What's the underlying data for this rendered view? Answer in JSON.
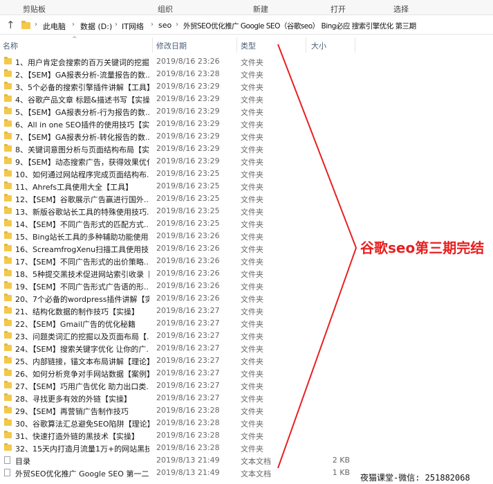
{
  "ribbon": {
    "groups": [
      "剪贴板",
      "组织",
      "新建",
      "打开",
      "选择"
    ]
  },
  "address_bar": {
    "crumbs": [
      "此电脑",
      "数据 (D:)",
      "IT网络",
      "seo",
      "外贸SEO优化推广 Google SEO（谷歌seo） Bing必应 搜索引擎优化 第三期"
    ]
  },
  "columns": {
    "name": "名称",
    "date": "修改日期",
    "type": "类型",
    "size": "大小"
  },
  "files": [
    {
      "name": "1、用户肯定会搜索的百万关键词的挖掘...",
      "date": "2019/8/16 23:26",
      "type": "文件夹",
      "size": "",
      "kind": "folder"
    },
    {
      "name": "2、【SEM】GA报表分析-流量报告的数...",
      "date": "2019/8/16 23:28",
      "type": "文件夹",
      "size": "",
      "kind": "folder"
    },
    {
      "name": "3、5个必备的搜索引擎插件讲解【工具】",
      "date": "2019/8/16 23:29",
      "type": "文件夹",
      "size": "",
      "kind": "folder"
    },
    {
      "name": "4、谷歌产品文章 标题&描述书写【实操】",
      "date": "2019/8/16 23:29",
      "type": "文件夹",
      "size": "",
      "kind": "folder"
    },
    {
      "name": "5、【SEM】GA报表分析-行为报告的数...",
      "date": "2019/8/16 23:29",
      "type": "文件夹",
      "size": "",
      "kind": "folder"
    },
    {
      "name": "6、All in one SEO插件的使用技巧【实...",
      "date": "2019/8/16 23:29",
      "type": "文件夹",
      "size": "",
      "kind": "folder"
    },
    {
      "name": "7、【SEM】GA报表分析-转化报告的数...",
      "date": "2019/8/16 23:29",
      "type": "文件夹",
      "size": "",
      "kind": "folder"
    },
    {
      "name": "8、关键词意图分析与页面结构布局【实...",
      "date": "2019/8/16 23:29",
      "type": "文件夹",
      "size": "",
      "kind": "folder"
    },
    {
      "name": "9、【SEM】动态搜索广告，获得效果优化",
      "date": "2019/8/16 23:29",
      "type": "文件夹",
      "size": "",
      "kind": "folder"
    },
    {
      "name": "10、如何通过网站程序完成页面结构布...",
      "date": "2019/8/16 23:25",
      "type": "文件夹",
      "size": "",
      "kind": "folder"
    },
    {
      "name": "11、Ahrefs工具使用大全【工具】",
      "date": "2019/8/16 23:25",
      "type": "文件夹",
      "size": "",
      "kind": "folder"
    },
    {
      "name": "12、【SEM】谷歌展示广告赢进行国外...",
      "date": "2019/8/16 23:25",
      "type": "文件夹",
      "size": "",
      "kind": "folder"
    },
    {
      "name": "13、新版谷歌站长工具的特殊使用技巧...",
      "date": "2019/8/16 23:25",
      "type": "文件夹",
      "size": "",
      "kind": "folder"
    },
    {
      "name": "14、【SEM】不同广告形式的匹配方式...",
      "date": "2019/8/16 23:25",
      "type": "文件夹",
      "size": "",
      "kind": "folder"
    },
    {
      "name": "15、Bing站长工具的多种辅助功能使用...",
      "date": "2019/8/16 23:26",
      "type": "文件夹",
      "size": "",
      "kind": "folder"
    },
    {
      "name": "16、ScreamfrogXenu扫描工具使用技...",
      "date": "2019/8/16 23:26",
      "type": "文件夹",
      "size": "",
      "kind": "folder"
    },
    {
      "name": "17、【SEM】不同广告形式的出价策略...",
      "date": "2019/8/16 23:26",
      "type": "文件夹",
      "size": "",
      "kind": "folder"
    },
    {
      "name": "18、5种提交黑技术促进网站索引收录【...",
      "date": "2019/8/16 23:26",
      "type": "文件夹",
      "size": "",
      "kind": "folder"
    },
    {
      "name": "19、【SEM】不同广告形式广告语的形...",
      "date": "2019/8/16 23:26",
      "type": "文件夹",
      "size": "",
      "kind": "folder"
    },
    {
      "name": "20、7个必备的wordpress插件讲解【实...",
      "date": "2019/8/16 23:26",
      "type": "文件夹",
      "size": "",
      "kind": "folder"
    },
    {
      "name": "21、结构化数据的制作技巧【实操】",
      "date": "2019/8/16 23:27",
      "type": "文件夹",
      "size": "",
      "kind": "folder"
    },
    {
      "name": "22、【SEM】Gmail广告的优化秘籍",
      "date": "2019/8/16 23:27",
      "type": "文件夹",
      "size": "",
      "kind": "folder"
    },
    {
      "name": "23、问题类词汇的挖掘以及页面布局【...",
      "date": "2019/8/16 23:27",
      "type": "文件夹",
      "size": "",
      "kind": "folder"
    },
    {
      "name": "24、【SEM】搜索关键字优化 让你的广...",
      "date": "2019/8/16 23:27",
      "type": "文件夹",
      "size": "",
      "kind": "folder"
    },
    {
      "name": "25、内部链接，锚文本布局讲解【理论】",
      "date": "2019/8/16 23:27",
      "type": "文件夹",
      "size": "",
      "kind": "folder"
    },
    {
      "name": "26、如何分析竞争对手网站数据【案例】",
      "date": "2019/8/16 23:27",
      "type": "文件夹",
      "size": "",
      "kind": "folder"
    },
    {
      "name": "27、【SEM】巧用广告优化 助力出口类...",
      "date": "2019/8/16 23:27",
      "type": "文件夹",
      "size": "",
      "kind": "folder"
    },
    {
      "name": "28、寻找更多有效的外链【实操】",
      "date": "2019/8/16 23:27",
      "type": "文件夹",
      "size": "",
      "kind": "folder"
    },
    {
      "name": "29、【SEM】再营销广告制作技巧",
      "date": "2019/8/16 23:28",
      "type": "文件夹",
      "size": "",
      "kind": "folder"
    },
    {
      "name": "30、谷歌算法汇总避免SEO陷阱【理论】",
      "date": "2019/8/16 23:28",
      "type": "文件夹",
      "size": "",
      "kind": "folder"
    },
    {
      "name": "31、快速打造外链的黑技术【实操】",
      "date": "2019/8/16 23:28",
      "type": "文件夹",
      "size": "",
      "kind": "folder"
    },
    {
      "name": "32、15天内打造月流量1万+的网站黑技...",
      "date": "2019/8/16 23:28",
      "type": "文件夹",
      "size": "",
      "kind": "folder"
    },
    {
      "name": "目录",
      "date": "2019/8/13 21:49",
      "type": "文本文档",
      "size": "2 KB",
      "kind": "doc"
    },
    {
      "name": "外贸SEO优化推广 Google SEO 第一二...",
      "date": "2019/8/13 21:49",
      "type": "文本文档",
      "size": "1 KB",
      "kind": "doc"
    }
  ],
  "annotation": {
    "text": "谷歌seo第三期完结",
    "color": "#e81f1f"
  },
  "watermark": {
    "text": "夜猫课堂-微信: 251882068"
  }
}
